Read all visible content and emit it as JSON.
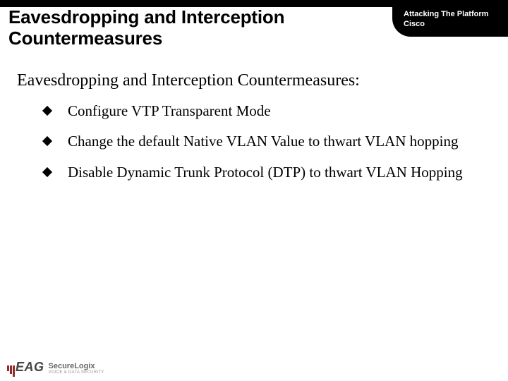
{
  "header": {
    "title": "Eavesdropping and Interception Countermeasures",
    "chapter_line1": "Attacking The Platform",
    "chapter_line2": "Cisco"
  },
  "subheading": "Eavesdropping and Interception Countermeasures:",
  "bullets": [
    "Configure VTP Transparent Mode",
    "Change the default Native VLAN Value to thwart VLAN hopping",
    "Disable Dynamic Trunk Protocol (DTP) to thwart VLAN Hopping"
  ],
  "footer": {
    "logo_initials": "EAG",
    "logo_brand": "SecureLogix",
    "logo_tagline": "VOICE & DATA SECURITY"
  }
}
